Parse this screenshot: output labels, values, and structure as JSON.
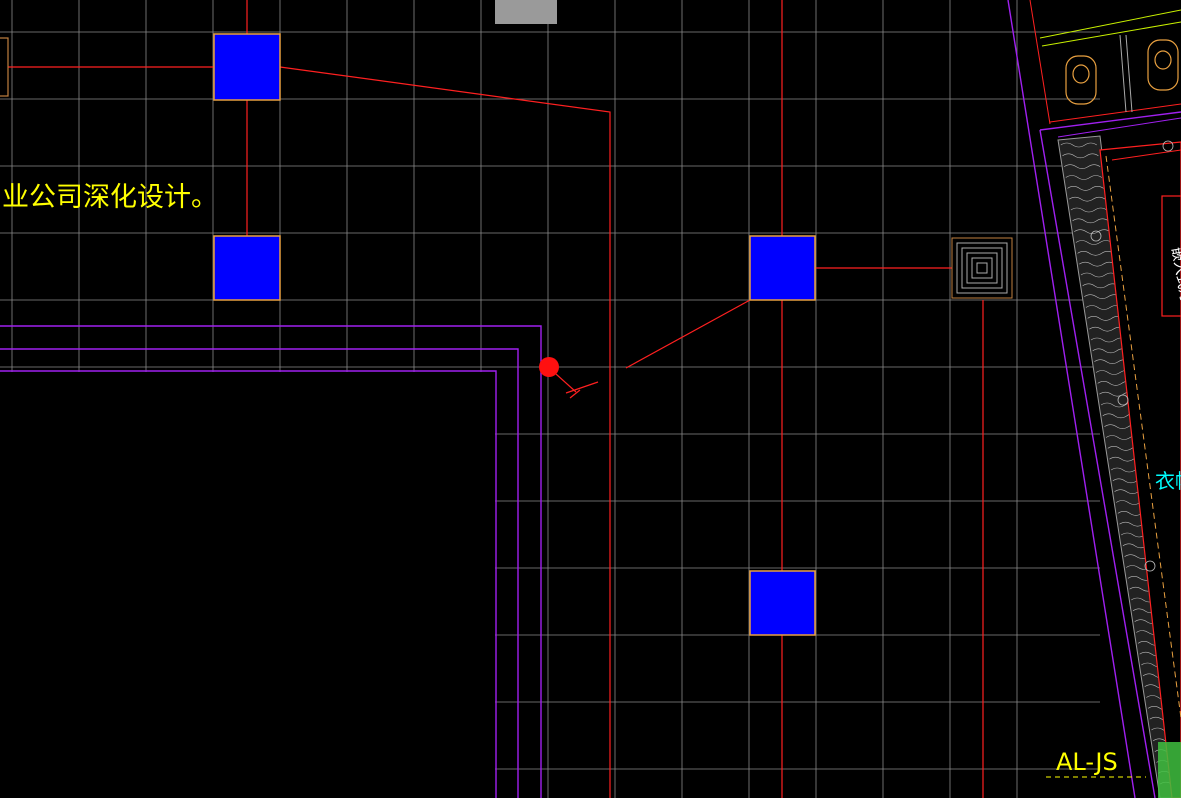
{
  "drawing": {
    "colors": {
      "background": "#000000",
      "grid": "#8a8a8a",
      "wire": "#ff2020",
      "fixture_fill": "#0000ff",
      "fixture_border": "#e8a040",
      "wall": "#a020f0",
      "annotation_yellow": "#ffff00",
      "annotation_cyan": "#00ffff",
      "panel_gray": "#9a9a9a",
      "wood_hatch": "#bbbbbb",
      "lime": "#c8f000",
      "green": "#40c040"
    },
    "annotations": {
      "design_note": "业公司深化设计。",
      "cabinet_label": "衣帽",
      "side_label": "嵌入式灯",
      "box_label": "AL-JS"
    },
    "icons": {
      "ceiling_fixture": "square-fixture-icon",
      "diffuser": "concentric-square-diffuser-icon",
      "junction": "red-junction-dot-icon",
      "toilet": "toilet-fixture-icon"
    }
  }
}
